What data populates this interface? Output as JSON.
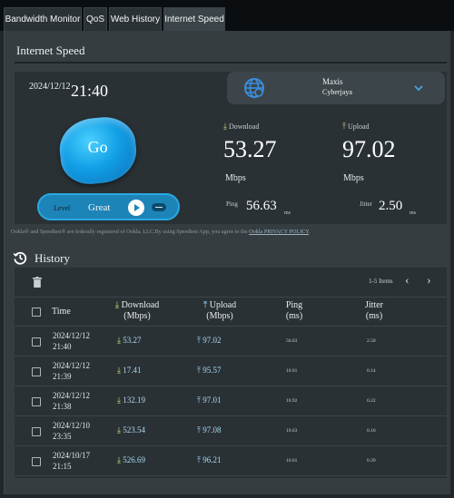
{
  "tabs": [
    {
      "label": "Bandwidth Monitor"
    },
    {
      "label": "QoS"
    },
    {
      "label": "Web History"
    },
    {
      "label": "Internet Speed"
    }
  ],
  "section_title": "Internet Speed",
  "datetime": {
    "date": "2024/12/12",
    "time": "21:40"
  },
  "server": {
    "name": "Maxis",
    "location": "Cyberjaya",
    "icon": "globe-icon"
  },
  "go_button_label": "Go",
  "download": {
    "label": "Download",
    "value": "53.27",
    "unit": "Mbps"
  },
  "upload": {
    "label": "Upload",
    "value": "97.02",
    "unit": "Mbps"
  },
  "ping": {
    "label": "Ping",
    "value": "56.63",
    "unit": "ms"
  },
  "jitter": {
    "label": "Jitter",
    "value": "2.50",
    "unit": "ms"
  },
  "level": {
    "label": "Level",
    "value": "Great"
  },
  "legal": {
    "text": "Ookla® and Speedtest® are federally registered of Ookla, LLC.By using Speedtest App, you agree to the",
    "link": "Ookla PRIVACY POLICY",
    "tail": "."
  },
  "history": {
    "title": "History",
    "pager": "1-5 Items",
    "headers": {
      "time": "Time",
      "download_1": "Download",
      "download_2": "(Mbps)",
      "upload_1": "Upload",
      "upload_2": "(Mbps)",
      "ping_1": "Ping",
      "ping_2": "(ms)",
      "jitter_1": "Jitter",
      "jitter_2": "(ms)"
    },
    "rows": [
      {
        "date": "2024/12/12",
        "time": "21:40",
        "download": "53.27",
        "upload": "97.02",
        "ping": "56.63",
        "jitter": "2.50"
      },
      {
        "date": "2024/12/12",
        "time": "21:39",
        "download": "17.41",
        "upload": "95.57",
        "ping": "10.91",
        "jitter": "0.14"
      },
      {
        "date": "2024/12/12",
        "time": "21:38",
        "download": "132.19",
        "upload": "97.01",
        "ping": "10.92",
        "jitter": "0.22"
      },
      {
        "date": "2024/12/10",
        "time": "23:35",
        "download": "523.54",
        "upload": "97.08",
        "ping": "10.63",
        "jitter": "0.16"
      },
      {
        "date": "2024/10/17",
        "time": "21:15",
        "download": "526.69",
        "upload": "96.21",
        "ping": "10.61",
        "jitter": "0.39"
      }
    ]
  },
  "colors": {
    "accent": "#1d84b8",
    "go_button": "#129fe6",
    "download_icon": "#c8e07a",
    "upload_icon": "#9ad6ff"
  }
}
